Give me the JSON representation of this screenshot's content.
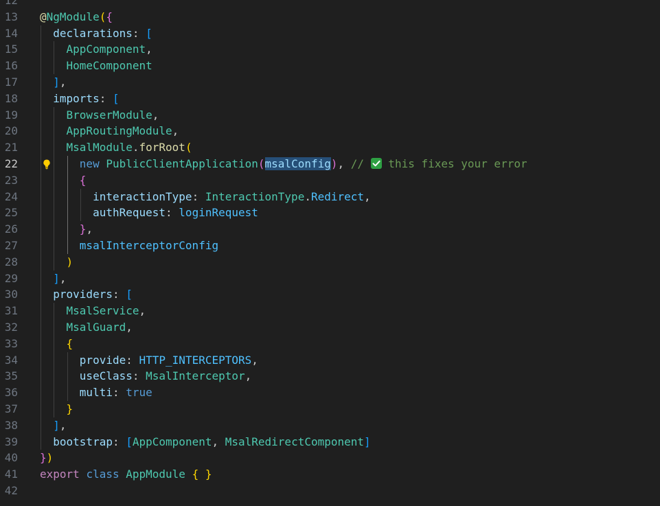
{
  "colors": {
    "background": "#1f1f1f",
    "line_number": "#6e7681",
    "line_number_active": "#cccccc",
    "keyword": "#569cd6",
    "control_keyword": "#c586c0",
    "class_type": "#4ec9b0",
    "property": "#9cdcfe",
    "function": "#dcdcaa",
    "constant": "#4fc1ff",
    "comment": "#6a9955",
    "punctuation": "#cccccc",
    "bracket_gold": "#ffd700",
    "bracket_pink": "#da70d6",
    "bracket_blue": "#179fff",
    "decorator": "#dcdcaa",
    "selection": "#264f78"
  },
  "editor": {
    "active_line": 22,
    "lightbulb_icon": "lightbulb-icon",
    "lines": [
      {
        "n": 12,
        "tokens": []
      },
      {
        "n": 13,
        "tokens": [
          {
            "t": "@",
            "c": "decorator"
          },
          {
            "t": "NgModule",
            "c": "class_type"
          },
          {
            "t": "(",
            "c": "bracket_gold"
          },
          {
            "t": "{",
            "c": "bracket_pink"
          }
        ]
      },
      {
        "n": 14,
        "tokens": [
          {
            "t": "  "
          },
          {
            "t": "declarations",
            "c": "property"
          },
          {
            "t": ": ",
            "c": "punctuation"
          },
          {
            "t": "[",
            "c": "bracket_blue"
          }
        ]
      },
      {
        "n": 15,
        "tokens": [
          {
            "t": "    "
          },
          {
            "t": "AppComponent",
            "c": "class_type"
          },
          {
            "t": ",",
            "c": "punctuation"
          }
        ]
      },
      {
        "n": 16,
        "tokens": [
          {
            "t": "    "
          },
          {
            "t": "HomeComponent",
            "c": "class_type"
          }
        ]
      },
      {
        "n": 17,
        "tokens": [
          {
            "t": "  "
          },
          {
            "t": "]",
            "c": "bracket_blue"
          },
          {
            "t": ",",
            "c": "punctuation"
          }
        ]
      },
      {
        "n": 18,
        "tokens": [
          {
            "t": "  "
          },
          {
            "t": "imports",
            "c": "property"
          },
          {
            "t": ": ",
            "c": "punctuation"
          },
          {
            "t": "[",
            "c": "bracket_blue"
          }
        ]
      },
      {
        "n": 19,
        "tokens": [
          {
            "t": "    "
          },
          {
            "t": "BrowserModule",
            "c": "class_type"
          },
          {
            "t": ",",
            "c": "punctuation"
          }
        ]
      },
      {
        "n": 20,
        "tokens": [
          {
            "t": "    "
          },
          {
            "t": "AppRoutingModule",
            "c": "class_type"
          },
          {
            "t": ",",
            "c": "punctuation"
          }
        ]
      },
      {
        "n": 21,
        "tokens": [
          {
            "t": "    "
          },
          {
            "t": "MsalModule",
            "c": "class_type"
          },
          {
            "t": ".",
            "c": "punctuation"
          },
          {
            "t": "forRoot",
            "c": "function"
          },
          {
            "t": "(",
            "c": "bracket_gold"
          }
        ]
      },
      {
        "n": 22,
        "tokens": [
          {
            "t": "      "
          },
          {
            "t": "new ",
            "c": "keyword"
          },
          {
            "t": "PublicClientApplication",
            "c": "class_type"
          },
          {
            "t": "(",
            "c": "bracket_pink"
          },
          {
            "t": "msalConfig",
            "c": "property",
            "hl": true
          },
          {
            "t": ")",
            "c": "bracket_pink"
          },
          {
            "t": ", ",
            "c": "punctuation"
          },
          {
            "t": "// ",
            "c": "comment"
          },
          {
            "t": "✅",
            "c": "comment",
            "icon": "check-icon"
          },
          {
            "t": " this fixes your error",
            "c": "comment"
          }
        ]
      },
      {
        "n": 23,
        "tokens": [
          {
            "t": "      "
          },
          {
            "t": "{",
            "c": "bracket_pink"
          }
        ]
      },
      {
        "n": 24,
        "tokens": [
          {
            "t": "        "
          },
          {
            "t": "interactionType",
            "c": "property"
          },
          {
            "t": ": ",
            "c": "punctuation"
          },
          {
            "t": "InteractionType",
            "c": "class_type"
          },
          {
            "t": ".",
            "c": "punctuation"
          },
          {
            "t": "Redirect",
            "c": "constant"
          },
          {
            "t": ",",
            "c": "punctuation"
          }
        ]
      },
      {
        "n": 25,
        "tokens": [
          {
            "t": "        "
          },
          {
            "t": "authRequest",
            "c": "property"
          },
          {
            "t": ": ",
            "c": "punctuation"
          },
          {
            "t": "loginRequest",
            "c": "constant"
          }
        ]
      },
      {
        "n": 26,
        "tokens": [
          {
            "t": "      "
          },
          {
            "t": "}",
            "c": "bracket_pink"
          },
          {
            "t": ",",
            "c": "punctuation"
          }
        ]
      },
      {
        "n": 27,
        "tokens": [
          {
            "t": "      "
          },
          {
            "t": "msalInterceptorConfig",
            "c": "constant"
          }
        ]
      },
      {
        "n": 28,
        "tokens": [
          {
            "t": "    "
          },
          {
            "t": ")",
            "c": "bracket_gold"
          }
        ]
      },
      {
        "n": 29,
        "tokens": [
          {
            "t": "  "
          },
          {
            "t": "]",
            "c": "bracket_blue"
          },
          {
            "t": ",",
            "c": "punctuation"
          }
        ]
      },
      {
        "n": 30,
        "tokens": [
          {
            "t": "  "
          },
          {
            "t": "providers",
            "c": "property"
          },
          {
            "t": ": ",
            "c": "punctuation"
          },
          {
            "t": "[",
            "c": "bracket_blue"
          }
        ]
      },
      {
        "n": 31,
        "tokens": [
          {
            "t": "    "
          },
          {
            "t": "MsalService",
            "c": "class_type"
          },
          {
            "t": ",",
            "c": "punctuation"
          }
        ]
      },
      {
        "n": 32,
        "tokens": [
          {
            "t": "    "
          },
          {
            "t": "MsalGuard",
            "c": "class_type"
          },
          {
            "t": ",",
            "c": "punctuation"
          }
        ]
      },
      {
        "n": 33,
        "tokens": [
          {
            "t": "    "
          },
          {
            "t": "{",
            "c": "bracket_gold"
          }
        ]
      },
      {
        "n": 34,
        "tokens": [
          {
            "t": "      "
          },
          {
            "t": "provide",
            "c": "property"
          },
          {
            "t": ": ",
            "c": "punctuation"
          },
          {
            "t": "HTTP_INTERCEPTORS",
            "c": "constant"
          },
          {
            "t": ",",
            "c": "punctuation"
          }
        ]
      },
      {
        "n": 35,
        "tokens": [
          {
            "t": "      "
          },
          {
            "t": "useClass",
            "c": "property"
          },
          {
            "t": ": ",
            "c": "punctuation"
          },
          {
            "t": "MsalInterceptor",
            "c": "class_type"
          },
          {
            "t": ",",
            "c": "punctuation"
          }
        ]
      },
      {
        "n": 36,
        "tokens": [
          {
            "t": "      "
          },
          {
            "t": "multi",
            "c": "property"
          },
          {
            "t": ": ",
            "c": "punctuation"
          },
          {
            "t": "true",
            "c": "keyword"
          }
        ]
      },
      {
        "n": 37,
        "tokens": [
          {
            "t": "    "
          },
          {
            "t": "}",
            "c": "bracket_gold"
          }
        ]
      },
      {
        "n": 38,
        "tokens": [
          {
            "t": "  "
          },
          {
            "t": "]",
            "c": "bracket_blue"
          },
          {
            "t": ",",
            "c": "punctuation"
          }
        ]
      },
      {
        "n": 39,
        "tokens": [
          {
            "t": "  "
          },
          {
            "t": "bootstrap",
            "c": "property"
          },
          {
            "t": ": ",
            "c": "punctuation"
          },
          {
            "t": "[",
            "c": "bracket_blue"
          },
          {
            "t": "AppComponent",
            "c": "class_type"
          },
          {
            "t": ", ",
            "c": "punctuation"
          },
          {
            "t": "MsalRedirectComponent",
            "c": "class_type"
          },
          {
            "t": "]",
            "c": "bracket_blue"
          }
        ]
      },
      {
        "n": 40,
        "tokens": [
          {
            "t": "}",
            "c": "bracket_pink"
          },
          {
            "t": ")",
            "c": "bracket_gold"
          }
        ]
      },
      {
        "n": 41,
        "tokens": [
          {
            "t": "export ",
            "c": "control_keyword"
          },
          {
            "t": "class ",
            "c": "keyword"
          },
          {
            "t": "AppModule",
            "c": "class_type"
          },
          {
            "t": " "
          },
          {
            "t": "{",
            "c": "bracket_gold"
          },
          {
            "t": " "
          },
          {
            "t": "}",
            "c": "bracket_gold"
          }
        ]
      },
      {
        "n": 42,
        "tokens": []
      }
    ]
  }
}
